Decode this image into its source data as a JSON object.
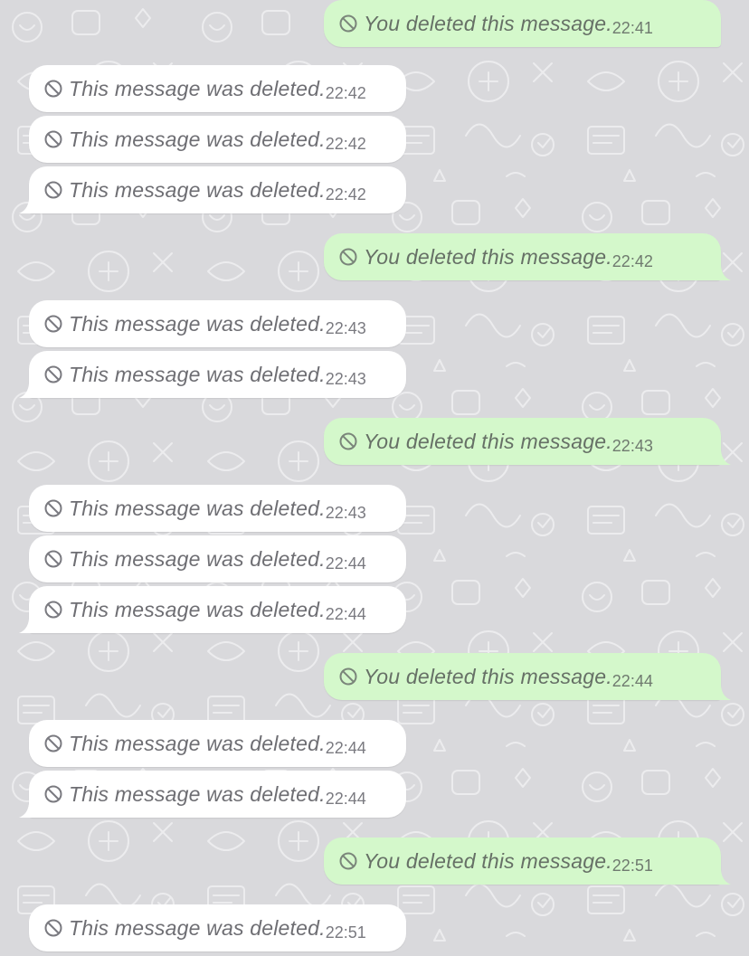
{
  "chat": {
    "messages": [
      {
        "direction": "out",
        "text": "You deleted this message.",
        "time": "22:41"
      },
      {
        "direction": "in",
        "text": "This message was deleted.",
        "time": "22:42"
      },
      {
        "direction": "in",
        "text": "This message was deleted.",
        "time": "22:42"
      },
      {
        "direction": "in",
        "text": "This message was deleted.",
        "time": "22:42"
      },
      {
        "direction": "out",
        "text": "You deleted this message.",
        "time": "22:42"
      },
      {
        "direction": "in",
        "text": "This message was deleted.",
        "time": "22:43"
      },
      {
        "direction": "in",
        "text": "This message was deleted.",
        "time": "22:43"
      },
      {
        "direction": "out",
        "text": "You deleted this message.",
        "time": "22:43"
      },
      {
        "direction": "in",
        "text": "This message was deleted.",
        "time": "22:43"
      },
      {
        "direction": "in",
        "text": "This message was deleted.",
        "time": "22:44"
      },
      {
        "direction": "in",
        "text": "This message was deleted.",
        "time": "22:44"
      },
      {
        "direction": "out",
        "text": "You deleted this message.",
        "time": "22:44"
      },
      {
        "direction": "in",
        "text": "This message was deleted.",
        "time": "22:44"
      },
      {
        "direction": "in",
        "text": "This message was deleted.",
        "time": "22:44"
      },
      {
        "direction": "out",
        "text": "You deleted this message.",
        "time": "22:51"
      },
      {
        "direction": "in",
        "text": "This message was deleted.",
        "time": "22:51"
      }
    ]
  },
  "colors": {
    "background": "#d9d9dc",
    "incoming_bubble": "#ffffff",
    "outgoing_bubble": "#d4f8cb",
    "deleted_text": "#6e6e73"
  },
  "icons": {
    "deleted": "ban-icon"
  }
}
